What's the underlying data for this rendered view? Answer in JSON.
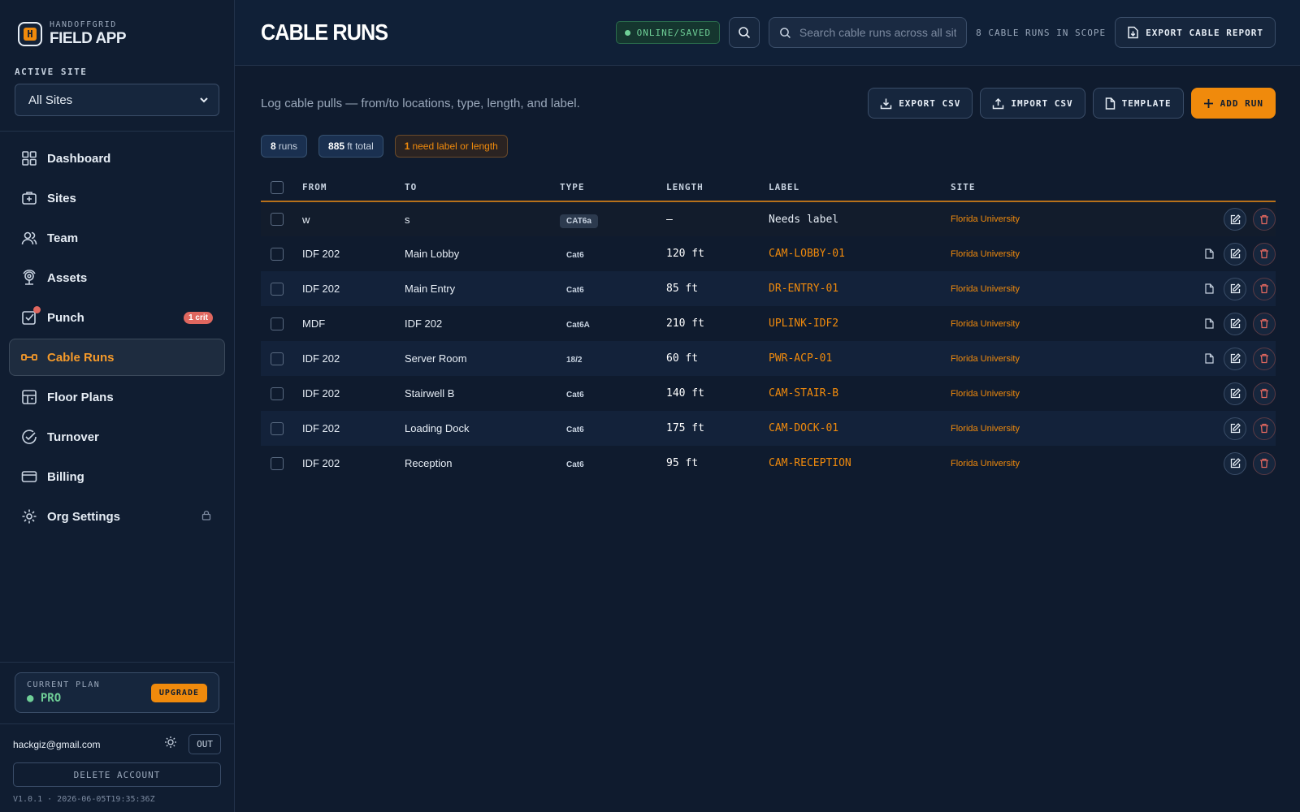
{
  "brand": {
    "sub": "HANDOFFGRID",
    "title": "FIELD APP",
    "logo_letter": "H"
  },
  "active_site": {
    "label": "ACTIVE SITE",
    "value": "All Sites"
  },
  "nav": [
    {
      "label": "Dashboard",
      "icon": "grid-icon"
    },
    {
      "label": "Sites",
      "icon": "briefcase-plus-icon"
    },
    {
      "label": "Team",
      "icon": "users-icon"
    },
    {
      "label": "Assets",
      "icon": "camera-icon"
    },
    {
      "label": "Punch",
      "icon": "checkbox-icon",
      "badge": "1 crit"
    },
    {
      "label": "Cable Runs",
      "icon": "cable-icon",
      "active": true
    },
    {
      "label": "Floor Plans",
      "icon": "floorplan-icon"
    },
    {
      "label": "Turnover",
      "icon": "check-circle-icon"
    },
    {
      "label": "Billing",
      "icon": "card-icon"
    },
    {
      "label": "Org Settings",
      "icon": "gear-icon",
      "locked": true
    }
  ],
  "plan": {
    "label": "CURRENT PLAN",
    "value": "PRO",
    "upgrade": "UPGRADE"
  },
  "account": {
    "email": "hackgiz@gmail.com",
    "out": "OUT",
    "delete": "DELETE ACCOUNT",
    "version": "V1.0.1 · 2026-06-05T19:35:36Z"
  },
  "header": {
    "title": "CABLE RUNS",
    "status": "ONLINE/SAVED",
    "search_placeholder": "Search cable runs across all sites",
    "scope": "8 CABLE RUNS IN SCOPE",
    "export_report": "EXPORT CABLE REPORT"
  },
  "toolbar": {
    "description": "Log cable pulls — from/to locations, type, length, and label.",
    "export_csv": "EXPORT CSV",
    "import_csv": "IMPORT CSV",
    "template": "TEMPLATE",
    "add_run": "ADD RUN"
  },
  "chips": {
    "runs_count": "8",
    "runs_label": "runs",
    "total_count": "885",
    "total_label": "ft total",
    "warn_count": "1",
    "warn_label": "need label or length"
  },
  "table": {
    "columns": [
      "FROM",
      "TO",
      "TYPE",
      "LENGTH",
      "LABEL",
      "SITE"
    ],
    "rows": [
      {
        "from": "w",
        "to": "s",
        "type": "CAT6a",
        "length": "—",
        "label": "Needs label",
        "site": "Florida University",
        "doc": false
      },
      {
        "from": "IDF 202",
        "to": "Main Lobby",
        "type": "Cat6",
        "length": "120 ft",
        "label": "CAM-LOBBY-01",
        "site": "Florida University",
        "doc": true
      },
      {
        "from": "IDF 202",
        "to": "Main Entry",
        "type": "Cat6",
        "length": "85 ft",
        "label": "DR-ENTRY-01",
        "site": "Florida University",
        "doc": true
      },
      {
        "from": "MDF",
        "to": "IDF 202",
        "type": "Cat6A",
        "length": "210 ft",
        "label": "UPLINK-IDF2",
        "site": "Florida University",
        "doc": true
      },
      {
        "from": "IDF 202",
        "to": "Server Room",
        "type": "18/2",
        "length": "60 ft",
        "label": "PWR-ACP-01",
        "site": "Florida University",
        "doc": true
      },
      {
        "from": "IDF 202",
        "to": "Stairwell B",
        "type": "Cat6",
        "length": "140 ft",
        "label": "CAM-STAIR-B",
        "site": "Florida University",
        "doc": false
      },
      {
        "from": "IDF 202",
        "to": "Loading Dock",
        "type": "Cat6",
        "length": "175 ft",
        "label": "CAM-DOCK-01",
        "site": "Florida University",
        "doc": false
      },
      {
        "from": "IDF 202",
        "to": "Reception",
        "type": "Cat6",
        "length": "95 ft",
        "label": "CAM-RECEPTION",
        "site": "Florida University",
        "doc": false
      }
    ]
  },
  "colors": {
    "accent": "#f08a0c",
    "online": "#6fcf97",
    "critical": "#e0675f",
    "background": "#0f1b2e"
  }
}
